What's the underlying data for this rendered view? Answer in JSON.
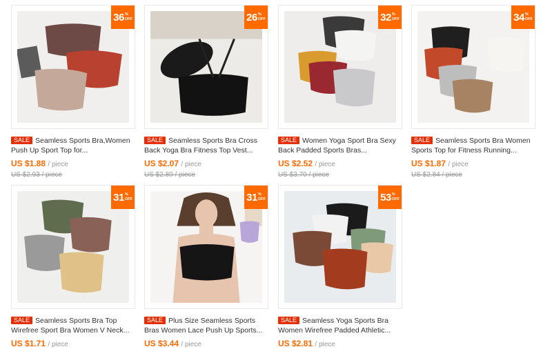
{
  "sale_badge": "SALE",
  "off_label": "OFF",
  "percent_sign": "%",
  "unit": "/ piece",
  "products": [
    {
      "discount": "36",
      "title": "Seamless Sports Bra,Women Push Up Sport Top for...",
      "price": "US $1.88",
      "original": "US $2.93 / piece"
    },
    {
      "discount": "26",
      "title": "Seamless Sports Bra Cross Back Yoga Bra Fitness Top Vest...",
      "price": "US $2.07",
      "original": "US $2.80 / piece"
    },
    {
      "discount": "32",
      "title": "Women Yoga Sport Bra Sexy Back Padded Sports Bras...",
      "price": "US $2.52",
      "original": "US $3.70 / piece"
    },
    {
      "discount": "34",
      "title": "Seamless Sports Bra Women Sports Top for Fitness Running...",
      "price": "US $1.87",
      "original": "US $2.84 / piece"
    },
    {
      "discount": "31",
      "title": "Seamless Sports Bra Top Wirefree Sport Bra Women V Neck...",
      "price": "US $1.71",
      "original": ""
    },
    {
      "discount": "31",
      "title": "Plus Size Seamless Sports Bras Women Lace Push Up Sports...",
      "price": "US $3.44",
      "original": ""
    },
    {
      "discount": "53",
      "title": "Seamless Yoga Sports Bra Women Wirefree Padded Athletic...",
      "price": "US $2.81",
      "original": ""
    }
  ],
  "colors": {
    "accent": "#ff6a00",
    "sale": "#e62e04",
    "muted": "#999999"
  }
}
